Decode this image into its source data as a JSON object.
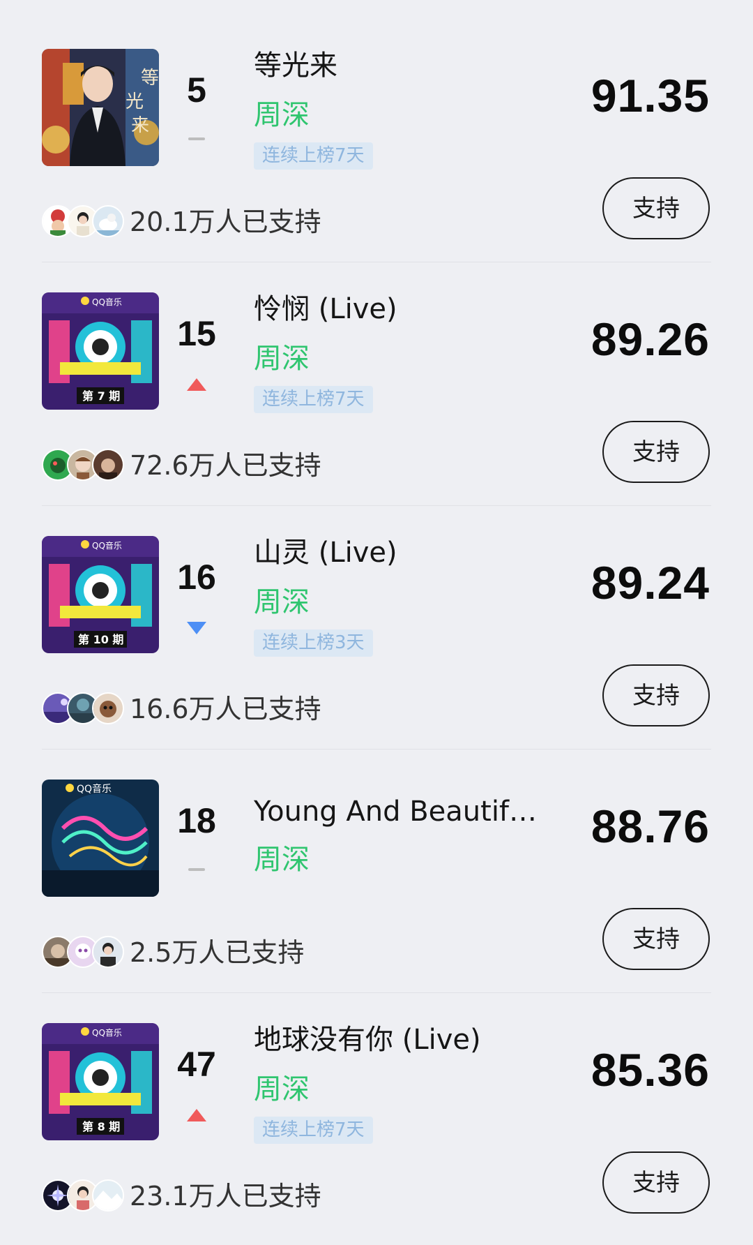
{
  "colors": {
    "background": "#eeeff3",
    "artist_green": "#2fc56f",
    "streak_bg": "#dce8f4",
    "streak_text": "#8fb6de",
    "trend_up": "#f05a5a",
    "trend_down": "#4d8ff5",
    "trend_flat": "#bdbdbd"
  },
  "songs": [
    {
      "rank": "5",
      "trend": "flat",
      "title": "等光来",
      "artist": "周深",
      "streak": "连续上榜7天",
      "score": "91.35",
      "supporters": "20.1万人已支持",
      "button": "支持",
      "cover": {
        "type": "portrait-poster",
        "caption": "等光来"
      }
    },
    {
      "rank": "15",
      "trend": "up",
      "title": "怜悯 (Live)",
      "artist": "周深",
      "streak": "连续上榜7天",
      "score": "89.26",
      "supporters": "72.6万人已支持",
      "button": "支持",
      "cover": {
        "type": "music-show-poster",
        "brand": "QQ音乐",
        "caption": "第 7 期"
      }
    },
    {
      "rank": "16",
      "trend": "down",
      "title": "山灵 (Live)",
      "artist": "周深",
      "streak": "连续上榜3天",
      "score": "89.24",
      "supporters": "16.6万人已支持",
      "button": "支持",
      "cover": {
        "type": "music-show-poster",
        "brand": "QQ音乐",
        "caption": "第 10 期"
      }
    },
    {
      "rank": "18",
      "trend": "flat",
      "title": "Young And Beautiful ...",
      "artist": "周深",
      "streak": "",
      "score": "88.76",
      "supporters": "2.5万人已支持",
      "button": "支持",
      "cover": {
        "type": "concert-poster",
        "brand": "QQ音乐"
      }
    },
    {
      "rank": "47",
      "trend": "up",
      "title": "地球没有你 (Live)",
      "artist": "周深",
      "streak": "连续上榜7天",
      "score": "85.36",
      "supporters": "23.1万人已支持",
      "button": "支持",
      "cover": {
        "type": "music-show-poster",
        "brand": "QQ音乐",
        "caption": "第 8 期"
      }
    }
  ]
}
